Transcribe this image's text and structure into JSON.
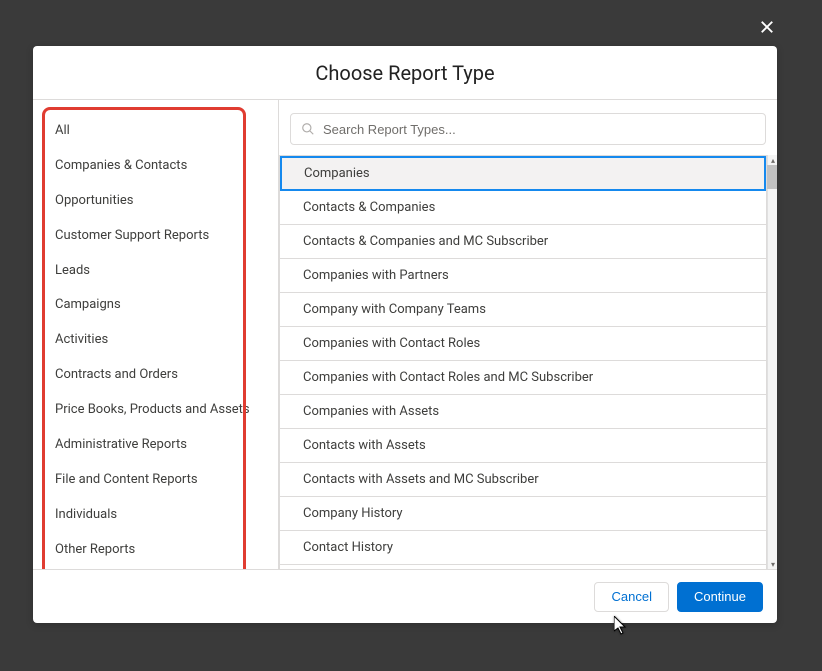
{
  "header": {
    "title": "Choose Report Type"
  },
  "search": {
    "placeholder": "Search Report Types..."
  },
  "sidebar": {
    "items": [
      "All",
      "Companies & Contacts",
      "Opportunities",
      "Customer Support Reports",
      "Leads",
      "Campaigns",
      "Activities",
      "Contracts and Orders",
      "Price Books, Products and Assets",
      "Administrative Reports",
      "File and Content Reports",
      "Individuals",
      "Other Reports"
    ]
  },
  "reportTypes": {
    "selectedIndex": 0,
    "items": [
      "Companies",
      "Contacts & Companies",
      "Contacts & Companies and MC Subscriber",
      "Companies with Partners",
      "Company with Company Teams",
      "Companies with Contact Roles",
      "Companies with Contact Roles and MC Subscriber",
      "Companies with Assets",
      "Contacts with Assets",
      "Contacts with Assets and MC Subscriber",
      "Company History",
      "Contact History"
    ]
  },
  "footer": {
    "cancel": "Cancel",
    "continue": "Continue"
  }
}
